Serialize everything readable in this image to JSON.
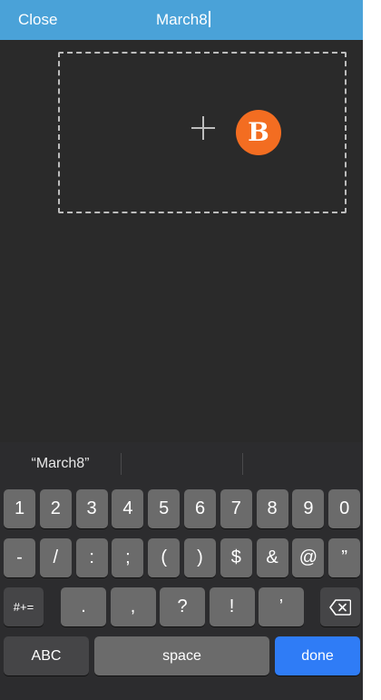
{
  "header": {
    "close_label": "Close",
    "title_value": "March8",
    "background": "#4aa2d8"
  },
  "canvas": {
    "badge_letter": "B",
    "badge_color": "#f36d21",
    "add_icon": "plus-icon"
  },
  "keyboard": {
    "suggestions": [
      "“March8”",
      "",
      ""
    ],
    "row1": [
      "1",
      "2",
      "3",
      "4",
      "5",
      "6",
      "7",
      "8",
      "9",
      "0"
    ],
    "row2": [
      "-",
      "/",
      ":",
      ";",
      "(",
      ")",
      "$",
      "&",
      "@",
      "”"
    ],
    "row3": {
      "symbols_label": "#+=",
      "keys": [
        ".",
        ",",
        "?",
        "!",
        "’"
      ],
      "backspace_icon": "backspace-icon"
    },
    "row4": {
      "abc_label": "ABC",
      "space_label": "space",
      "done_label": "done"
    },
    "done_color": "#2f7cf6"
  }
}
